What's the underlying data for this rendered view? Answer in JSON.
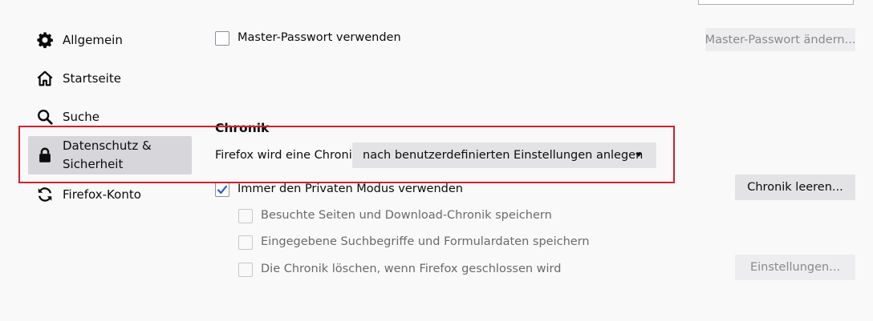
{
  "sidebar": {
    "items": [
      {
        "label": "Allgemein",
        "icon": "gear-icon"
      },
      {
        "label": "Startseite",
        "icon": "home-icon"
      },
      {
        "label": "Suche",
        "icon": "search-icon"
      },
      {
        "label_line1": "Datenschutz &",
        "label_line2": "Sicherheit",
        "icon": "lock-icon",
        "selected": true
      },
      {
        "label": "Firefox-Konto",
        "icon": "sync-icon"
      }
    ]
  },
  "passwords": {
    "master_password_label": "Master-Passwort verwenden",
    "master_password_checked": false,
    "change_master_password_button": "Master-Passwort ändern..."
  },
  "history": {
    "title": "Chronik",
    "firefox_will_label": "Firefox wird eine Chronik",
    "mode_select_value": "nach benutzerdefinierten Einstellungen anlegen",
    "clear_history_button": "Chronik leeren...",
    "always_private_label": "Immer den Privaten Modus verwenden",
    "always_private_checked": true,
    "remember_browsing_label": "Besuchte Seiten und Download-Chronik speichern",
    "remember_search_label": "Eingegebene Suchbegriffe und Formulardaten speichern",
    "clear_on_close_label": "Die Chronik löschen, wenn Firefox geschlossen wird",
    "settings_button": "Einstellungen..."
  },
  "colors": {
    "highlight": "#d0202a",
    "selected_bg": "#d7d7db",
    "page_bg": "#f9f9fa"
  }
}
